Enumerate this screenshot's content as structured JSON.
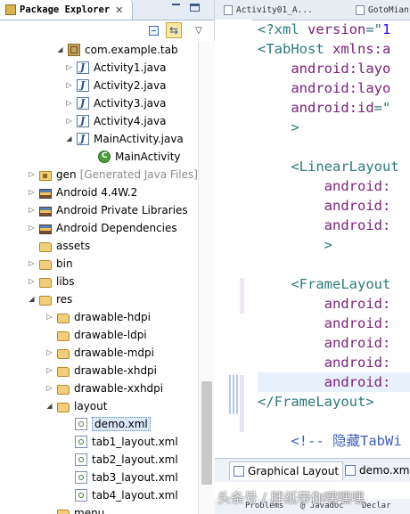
{
  "package_explorer": {
    "title": "Package Explorer",
    "close": "✕",
    "toolbar": {
      "menu": "▽"
    },
    "tree": [
      {
        "label": "com.example.tab",
        "icon": "package-icon",
        "expanded": true
      },
      {
        "label": "Activity1.java",
        "icon": "java-file-icon",
        "expanded": false
      },
      {
        "label": "Activity2.java",
        "icon": "java-file-icon",
        "expanded": false
      },
      {
        "label": "Activity3.java",
        "icon": "java-file-icon",
        "expanded": false
      },
      {
        "label": "Activity4.java",
        "icon": "java-file-icon",
        "expanded": false
      },
      {
        "label": "MainActivity.java",
        "icon": "java-file-icon",
        "expanded": true
      },
      {
        "label": "MainActivity",
        "icon": "class-icon"
      },
      {
        "label": "gen",
        "suffix": "[Generated Java Files]",
        "icon": "source-folder-icon",
        "expanded": false
      },
      {
        "label": "Android 4.4W.2",
        "icon": "library-icon",
        "expanded": false
      },
      {
        "label": "Android Private Libraries",
        "icon": "library-icon",
        "expanded": false
      },
      {
        "label": "Android Dependencies",
        "icon": "library-icon",
        "expanded": false
      },
      {
        "label": "assets",
        "icon": "folder-icon"
      },
      {
        "label": "bin",
        "icon": "folder-icon",
        "expanded": false
      },
      {
        "label": "libs",
        "icon": "folder-icon",
        "expanded": false
      },
      {
        "label": "res",
        "icon": "folder-icon",
        "expanded": true
      },
      {
        "label": "drawable-hdpi",
        "icon": "folder-icon",
        "expanded": false
      },
      {
        "label": "drawable-ldpi",
        "icon": "folder-icon"
      },
      {
        "label": "drawable-mdpi",
        "icon": "folder-icon",
        "expanded": false
      },
      {
        "label": "drawable-xhdpi",
        "icon": "folder-icon",
        "expanded": false
      },
      {
        "label": "drawable-xxhdpi",
        "icon": "folder-icon",
        "expanded": false
      },
      {
        "label": "layout",
        "icon": "folder-icon",
        "expanded": true
      },
      {
        "label": "demo.xml",
        "icon": "xml-file-icon",
        "selected": true
      },
      {
        "label": "tab1_layout.xml",
        "icon": "xml-file-icon"
      },
      {
        "label": "tab2_layout.xml",
        "icon": "xml-file-icon"
      },
      {
        "label": "tab3_layout.xml",
        "icon": "xml-file-icon"
      },
      {
        "label": "tab4_layout.xml",
        "icon": "xml-file-icon"
      },
      {
        "label": "menu",
        "icon": "folder-icon"
      }
    ]
  },
  "editor": {
    "tabs": [
      "Activity01_A...",
      "GotoMian"
    ],
    "code_lines": [
      [
        [
          "punc",
          "<?"
        ],
        [
          "tag",
          "xml"
        ],
        [
          "attr",
          " version"
        ],
        [
          "punc",
          "=\""
        ],
        [
          "val",
          "1"
        ]
      ],
      [
        [
          "punc",
          "<"
        ],
        [
          "tag",
          "TabHost"
        ],
        [
          "attr",
          " xmlns:a"
        ]
      ],
      [
        [
          "attr",
          "    android:layo"
        ]
      ],
      [
        [
          "attr",
          "    android:layo"
        ]
      ],
      [
        [
          "attr",
          "    android:id"
        ],
        [
          "punc",
          "=\""
        ]
      ],
      [
        [
          "punc",
          "    >"
        ]
      ],
      [
        [
          "punc",
          ""
        ]
      ],
      [
        [
          "punc",
          "    <"
        ],
        [
          "tag",
          "LinearLayout"
        ]
      ],
      [
        [
          "attr",
          "        android:"
        ]
      ],
      [
        [
          "attr",
          "        android:"
        ]
      ],
      [
        [
          "attr",
          "        android:"
        ]
      ],
      [
        [
          "punc",
          "        >"
        ]
      ],
      [
        [
          "punc",
          ""
        ]
      ],
      [
        [
          "punc",
          "    <"
        ],
        [
          "tag",
          "FrameLayout"
        ]
      ],
      [
        [
          "attr",
          "        android:"
        ]
      ],
      [
        [
          "attr",
          "        android:"
        ]
      ],
      [
        [
          "attr",
          "        android:"
        ]
      ],
      [
        [
          "attr",
          "        android:"
        ]
      ],
      [
        [
          "attr",
          "        android:"
        ]
      ],
      [
        [
          "punc",
          "</"
        ],
        [
          "tag",
          "FrameLayout"
        ],
        [
          "punc",
          ">"
        ]
      ],
      [
        [
          "punc",
          ""
        ]
      ],
      [
        [
          "comment",
          "    <!-- 隐藏TabWi"
        ]
      ]
    ],
    "highlighted_line": 18,
    "bottom_tabs": [
      "Graphical Layout",
      "demo.xml"
    ]
  },
  "bottom_views": [
    "Problems",
    "@ Javadoc",
    "Declar"
  ],
  "watermark": "头条号 / 胖纸带你嘿嘿嘿",
  "colors": {
    "tag": "#2d7a7a",
    "attribute": "#7a1f7a",
    "value": "#2a00ff",
    "comment": "#3f5fbf",
    "selection": "#dbe8f8"
  }
}
